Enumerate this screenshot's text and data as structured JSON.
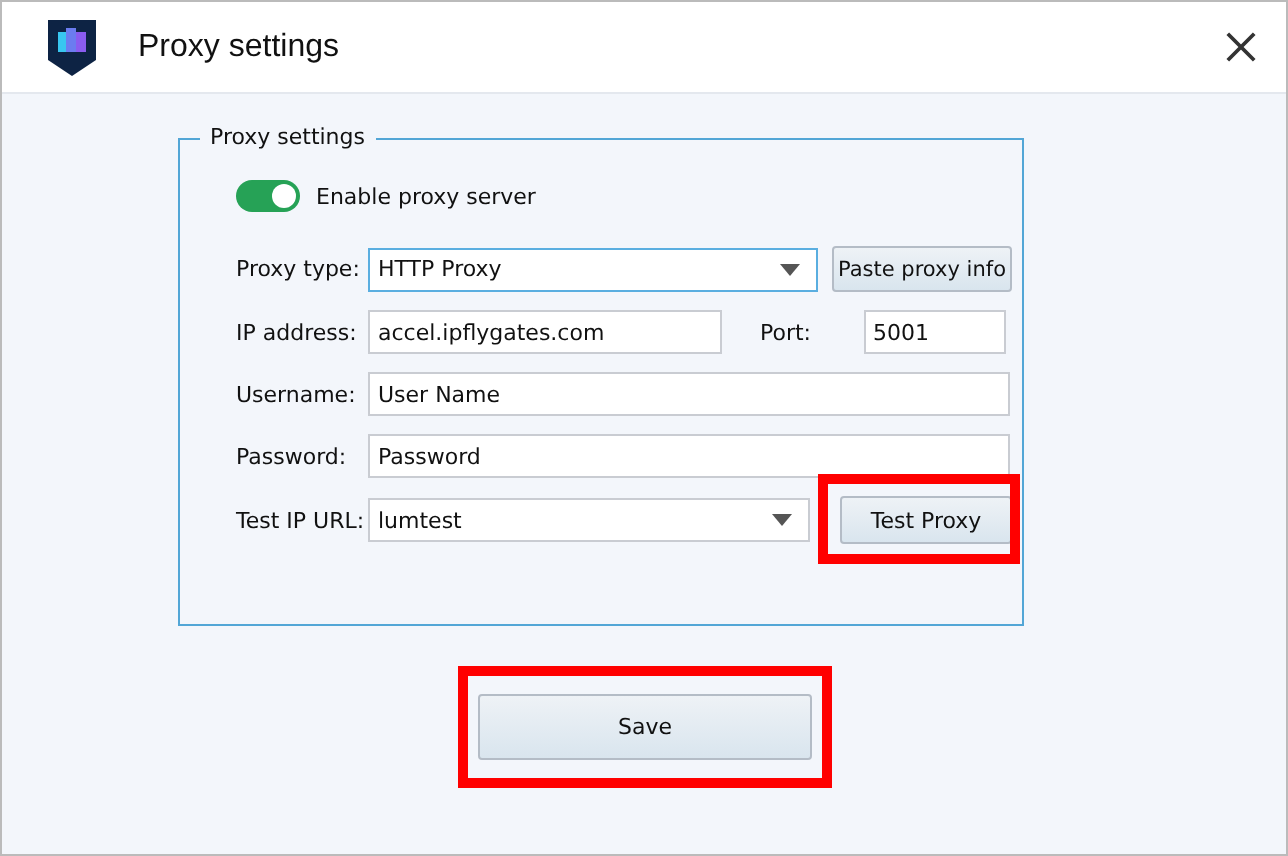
{
  "window": {
    "title": "Proxy settings"
  },
  "group": {
    "title": "Proxy settings"
  },
  "toggle": {
    "label": "Enable proxy server",
    "on": true
  },
  "proxy_type": {
    "label": "Proxy type:",
    "value": "HTTP Proxy"
  },
  "paste_button": {
    "label": "Paste proxy info"
  },
  "ip_address": {
    "label": "IP address:",
    "value": "accel.ipflygates.com"
  },
  "port": {
    "label": "Port:",
    "value": "5001"
  },
  "username": {
    "label": "Username:",
    "value": "User Name"
  },
  "password": {
    "label": "Password:",
    "value": "Password"
  },
  "test_url": {
    "label": "Test IP URL:",
    "value": "lumtest"
  },
  "test_button": {
    "label": "Test Proxy",
    "highlighted": true
  },
  "save_button": {
    "label": "Save",
    "highlighted": true
  }
}
